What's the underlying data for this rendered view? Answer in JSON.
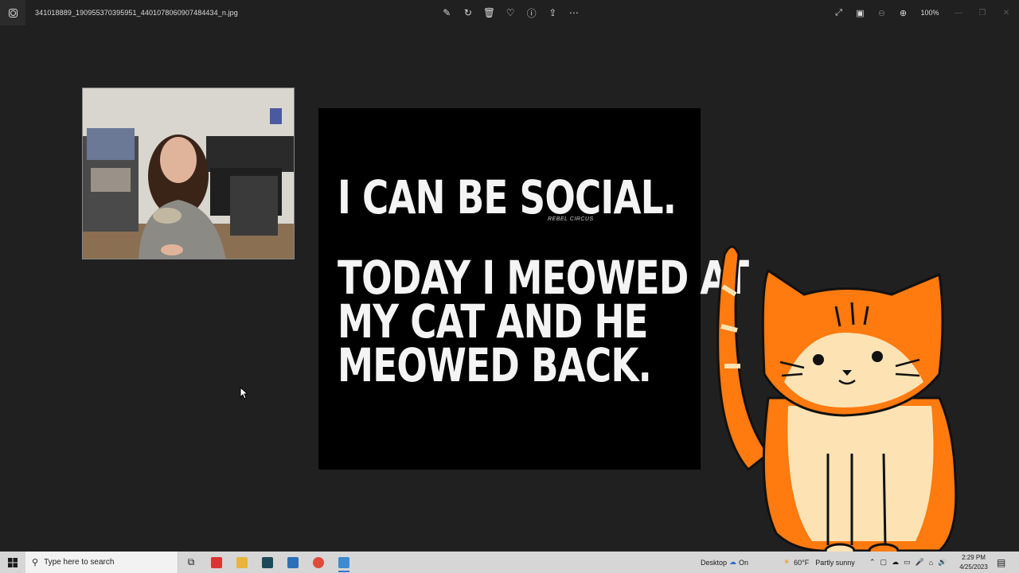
{
  "window": {
    "filename": "341018889_190955370395951_4401078060907484434_n.jpg",
    "zoom_label": "100%"
  },
  "toolbar": {
    "icons": [
      "edit-icon",
      "rotate-icon",
      "delete-icon",
      "favorite-heart-icon",
      "info-icon",
      "share-icon",
      "more-icon"
    ]
  },
  "meme": {
    "line1": "I CAN BE SOCIAL.",
    "signature": "REBEL CIRCUS",
    "line2": "TODAY I MEOWED AT",
    "line3": "MY CAT AND HE",
    "line4": "MEOWED BACK."
  },
  "taskbar": {
    "search_placeholder": "Type here to search",
    "desktop_label": "Desktop",
    "onedrive_label": "On",
    "weather_temp": "60°F",
    "weather_desc": "Partly sunny",
    "time": "2:29 PM",
    "date": "4/25/2023"
  },
  "colors": {
    "background": "#202020",
    "taskbar": "#d6d6d6",
    "cat_orange": "#ff7a0f",
    "cat_cream": "#fde3b4"
  }
}
